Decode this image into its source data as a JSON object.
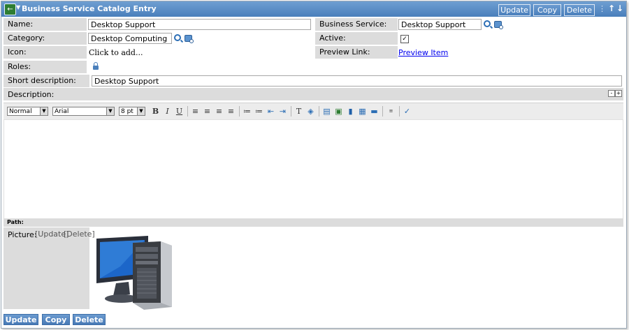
{
  "header": {
    "title": "Business Service Catalog Entry",
    "update_label": "Update",
    "copy_label": "Copy",
    "delete_label": "Delete"
  },
  "form": {
    "name": {
      "label": "Name:",
      "value": "Desktop Support"
    },
    "category": {
      "label": "Category:",
      "value": "Desktop Computing"
    },
    "icon": {
      "label": "Icon:",
      "value": "Click to add..."
    },
    "roles": {
      "label": "Roles:"
    },
    "short_description": {
      "label": "Short description:",
      "value": "Desktop Support"
    },
    "business_service": {
      "label": "Business Service:",
      "value": "Desktop Support"
    },
    "active": {
      "label": "Active:",
      "checked": true,
      "mark": "✓"
    },
    "preview_link": {
      "label": "Preview Link:",
      "link_text": "Preview Item"
    },
    "description": {
      "label": "Description:"
    },
    "picture": {
      "label": "Picture:",
      "update_link": "[Update]",
      "delete_link": "[Delete]"
    }
  },
  "editor_toolbar": {
    "format_select": "Normal",
    "font_select": "Arial",
    "size_select": "8 pt",
    "bold": "B",
    "italic": "I",
    "underline": "U",
    "path_label": "Path:"
  },
  "footer": {
    "update_label": "Update",
    "copy_label": "Copy",
    "delete_label": "Delete"
  },
  "colors": {
    "header_blue": "#5a8cc6",
    "label_gray": "#dcdcdc",
    "link_blue": "#0000ee"
  }
}
